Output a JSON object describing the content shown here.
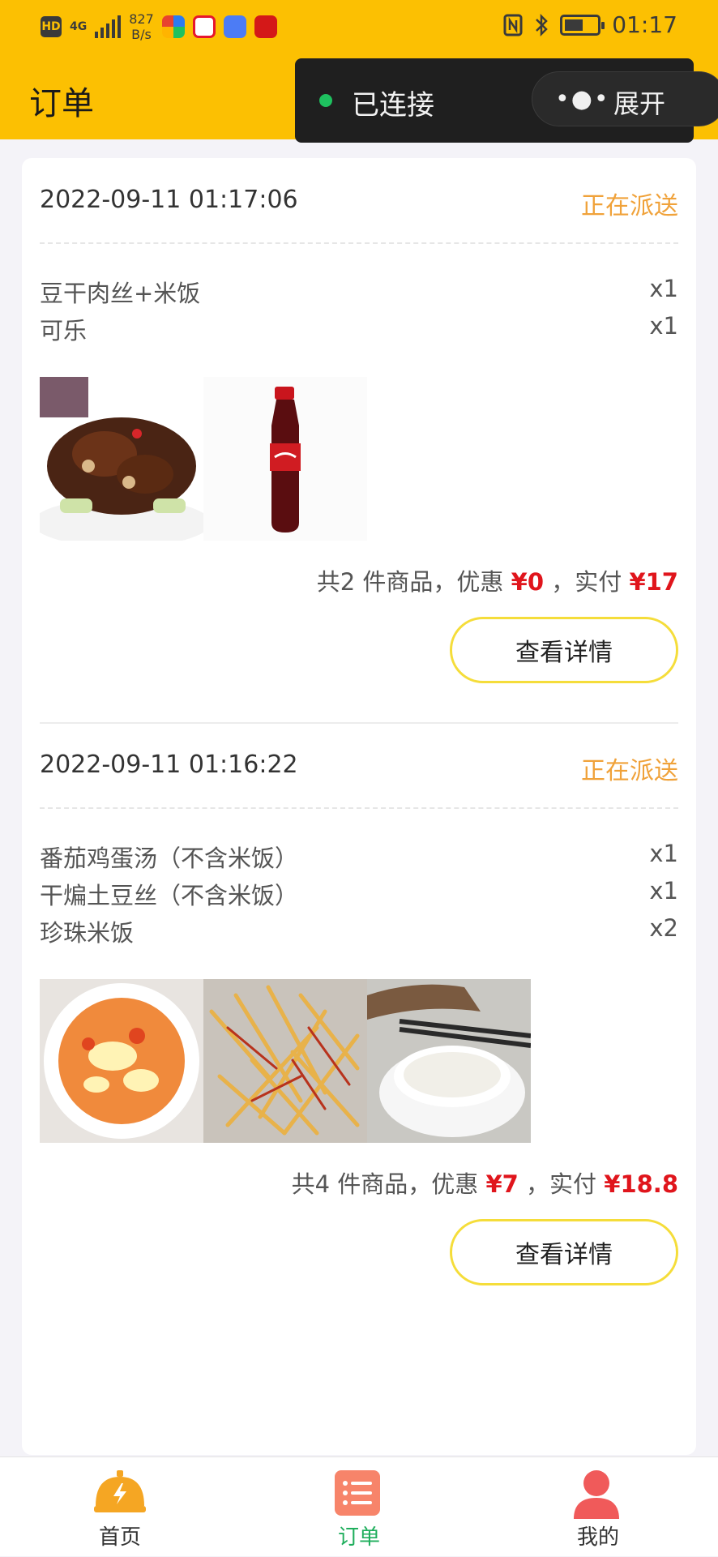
{
  "status_bar": {
    "network_type": "4G",
    "speed_value": "827",
    "speed_unit": "B/s",
    "time": "01:17"
  },
  "header": {
    "title": "订单"
  },
  "connection": {
    "status": "已连接",
    "expand_label": "展开"
  },
  "orders": [
    {
      "datetime": "2022-09-11 01:17:06",
      "status": "正在派送",
      "items": [
        {
          "name": "豆干肉丝+米饭",
          "qty": "x1"
        },
        {
          "name": "可乐",
          "qty": "x1"
        }
      ],
      "summary": {
        "count_text": "共2 件商品，优惠",
        "discount": "¥0",
        "pay_text": "，实付",
        "paid": "¥17"
      },
      "detail_button": "查看详情"
    },
    {
      "datetime": "2022-09-11 01:16:22",
      "status": "正在派送",
      "items": [
        {
          "name": "番茄鸡蛋汤（不含米饭）",
          "qty": "x1"
        },
        {
          "name": "干煸土豆丝（不含米饭）",
          "qty": "x1"
        },
        {
          "name": "珍珠米饭",
          "qty": "x2"
        }
      ],
      "summary": {
        "count_text": "共4 件商品，优惠",
        "discount": "¥7",
        "pay_text": "，实付",
        "paid": "¥18.8"
      },
      "detail_button": "查看详情"
    }
  ],
  "tabbar": {
    "home": "首页",
    "orders": "订单",
    "mine": "我的"
  },
  "colors": {
    "brand_yellow": "#fcc002",
    "status_orange": "#f0a23a",
    "price_red": "#e0151c",
    "active_green": "#1fae5c"
  }
}
